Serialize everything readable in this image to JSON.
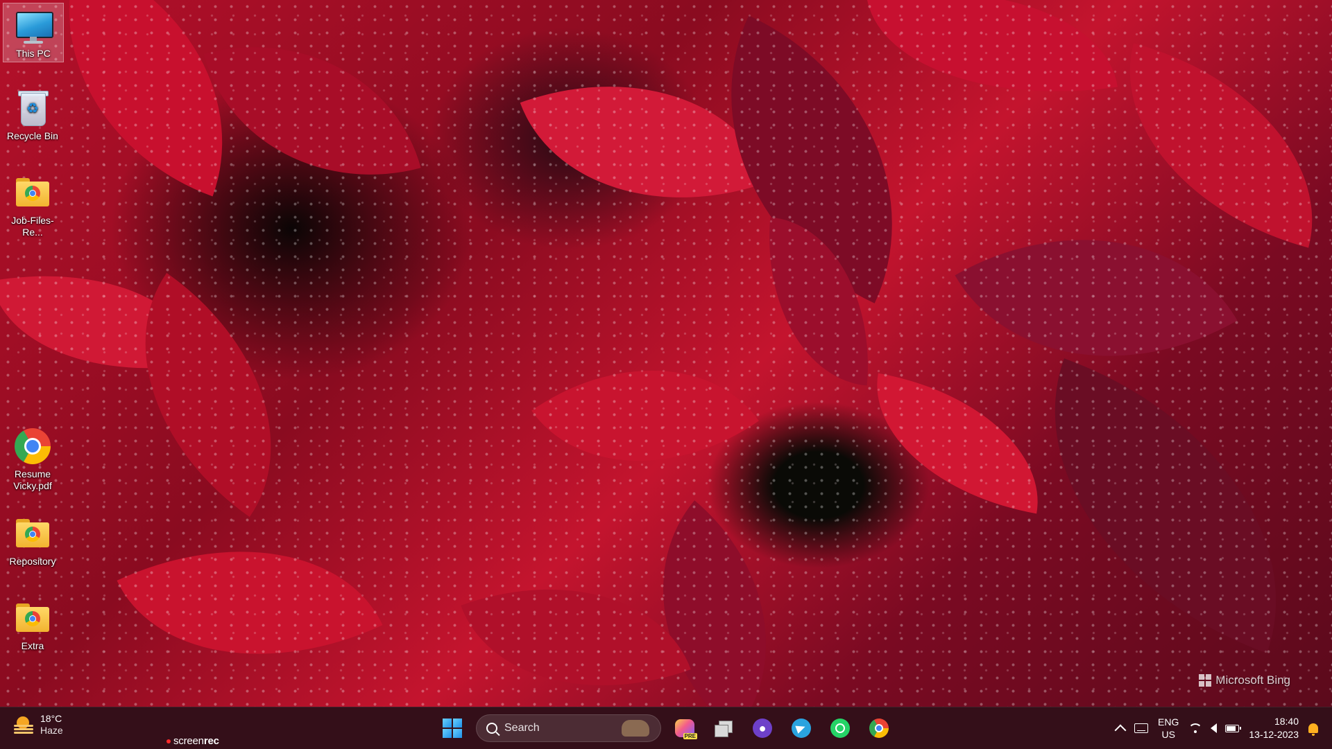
{
  "desktop": {
    "icons": [
      {
        "label": "This PC",
        "icon": "this-pc-icon",
        "selected": true
      },
      {
        "label": "Recycle Bin",
        "icon": "recycle-bin-icon"
      },
      {
        "label": "Job-Files-Re...",
        "icon": "folder-icon"
      },
      {
        "label": "Resume Vicky.pdf",
        "icon": "chrome-icon"
      },
      {
        "label": "Repository",
        "icon": "folder-icon"
      },
      {
        "label": "Extra",
        "icon": "folder-icon"
      }
    ]
  },
  "wallpaper": {
    "watermark": "Microsoft Bing",
    "accent_colors": [
      "#b5102a",
      "#8a0b20",
      "#5c0a1c"
    ]
  },
  "taskbar": {
    "weather": {
      "temp": "18°C",
      "condition": "Haze",
      "icon": "haze-weather-icon"
    },
    "overlay": {
      "brand_a": "screen",
      "brand_b": "rec"
    },
    "start_icon": "windows-start-icon",
    "search": {
      "placeholder": "Search",
      "icon": "search-icon"
    },
    "apps": [
      {
        "name": "copilot-icon",
        "badge": "PRE"
      },
      {
        "name": "task-view-icon"
      },
      {
        "name": "github-desktop-icon"
      },
      {
        "name": "telegram-icon"
      },
      {
        "name": "whatsapp-icon"
      },
      {
        "name": "chrome-icon"
      }
    ],
    "tray": {
      "language": {
        "line1": "ENG",
        "line2": "US"
      },
      "battery_level": 0.85,
      "time": "18:40",
      "date": "13-12-2023"
    }
  }
}
